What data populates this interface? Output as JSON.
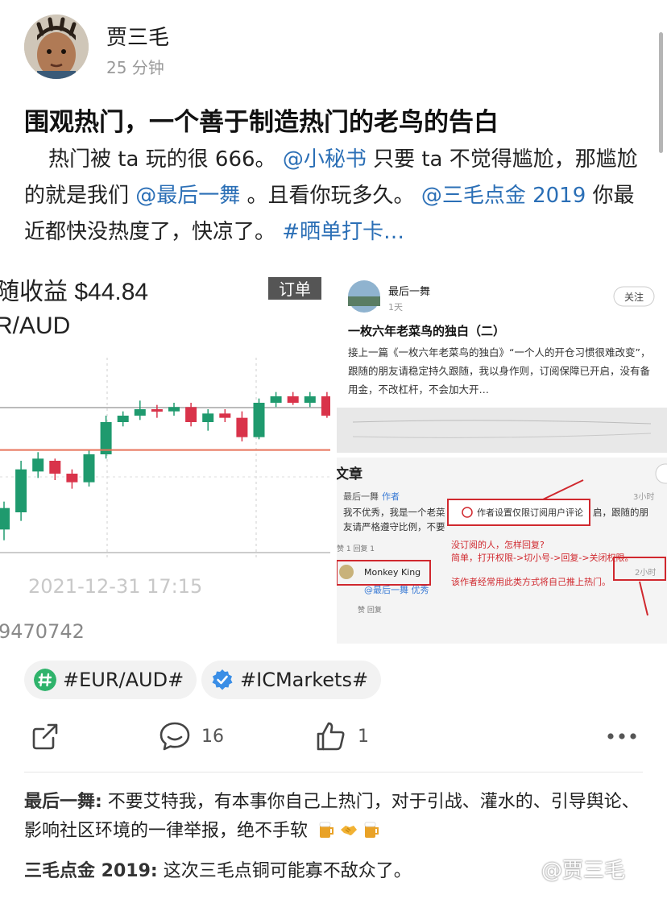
{
  "author": {
    "name": "贾三毛",
    "time": "25 分钟"
  },
  "post": {
    "title": "围观热门，一个善于制造热门的老鸟的告白",
    "segments": [
      {
        "text": "热门被 ta 玩的很 666。 ",
        "link": false
      },
      {
        "text": "@小秘书",
        "link": true
      },
      {
        "text": " 只要 ta 不觉得尴尬，那尴尬的就是我们 ",
        "link": false
      },
      {
        "text": "@最后一舞",
        "link": true
      },
      {
        "text": " 。且看你玩多久。 ",
        "link": false
      },
      {
        "text": "@三毛点金 2019",
        "link": true
      },
      {
        "text": " 你最近都快没热度了，快凉了。 ",
        "link": false
      },
      {
        "text": "#晒单打卡…",
        "link": true
      }
    ]
  },
  "images": {
    "chart_shot": {
      "headline": "随收益 $44.84",
      "pair": "R/AUD",
      "badge": "订单",
      "timestamp": "2021-12-31 17:15",
      "order_id": "9470742"
    },
    "article_shot": {
      "author": "最后一舞",
      "time": "1天",
      "follow": "关注",
      "title": "一枚六年老菜鸟的独白（二）",
      "excerpt": "接上一篇《一枚六年老菜鸟的独白》“一个人的开仓习惯很难改变”，跟随的朋友请稳定持久跟随，我以身作则，订阅保障已开启，没有备用金，不改杠杆，不会加大开…"
    },
    "comment_shot": {
      "tab": "文章",
      "c1_name": "最后一舞",
      "c1_tag": "作者",
      "c1_time": "3小时",
      "c1_text": "我不优秀，我是一个老菜",
      "c1_text_tail": "启，跟随的朋",
      "c1_line2": "友请严格遵守比例，不要",
      "popup": "作者设置仅限订阅用户评论",
      "c1_actions": "赞 1  回复 1",
      "note1": "没订阅的人，怎样回复?",
      "note2": "简单，打开权限->切小号->回复->关闭权限。",
      "note3": "该作者经常用此类方式将自己推上热门。",
      "c2_name": "Monkey King",
      "c2_time": "2小时",
      "c2_text": "@最后一舞 优秀",
      "c2_actions": "赞  回复"
    }
  },
  "topics": [
    {
      "label": "#EUR/AUD#",
      "icon": "hashtag-icon",
      "color": "#2fb36b"
    },
    {
      "label": "#ICMarkets#",
      "icon": "verified-icon",
      "color": "#3a8ee6"
    }
  ],
  "actions": {
    "comments": "16",
    "likes": "1"
  },
  "comments": [
    {
      "name": "最后一舞:",
      "text": " 不要艾特我，有本事你自己上热门，对于引战、灌水的、引导舆论、影响社区环境的一律举报，绝不手软",
      "emojis": [
        "beer-icon",
        "handshake-icon",
        "beer-icon"
      ]
    },
    {
      "name": "三毛点金 2019:",
      "text": " 这次三毛点铜可能寡不敌众了。",
      "emojis": []
    }
  ],
  "watermark": "@贾三毛",
  "chart_data": {
    "type": "candlestick",
    "title": "",
    "series": [
      {
        "name": "",
        "candles": [
          {
            "o": 1.552,
            "c": 1.553,
            "h": 1.5533,
            "l": 1.5515
          },
          {
            "o": 1.5528,
            "c": 1.5548,
            "h": 1.5552,
            "l": 1.5524
          },
          {
            "o": 1.5547,
            "c": 1.5553,
            "h": 1.5556,
            "l": 1.5544
          },
          {
            "o": 1.5552,
            "c": 1.5546,
            "h": 1.5553,
            "l": 1.5543
          },
          {
            "o": 1.5546,
            "c": 1.5542,
            "h": 1.5548,
            "l": 1.5539
          },
          {
            "o": 1.5542,
            "c": 1.5555,
            "h": 1.5557,
            "l": 1.554
          },
          {
            "o": 1.5555,
            "c": 1.557,
            "h": 1.5573,
            "l": 1.5553
          },
          {
            "o": 1.557,
            "c": 1.5573,
            "h": 1.5575,
            "l": 1.5568
          },
          {
            "o": 1.5573,
            "c": 1.5576,
            "h": 1.558,
            "l": 1.5571
          },
          {
            "o": 1.5576,
            "c": 1.5575,
            "h": 1.5578,
            "l": 1.5572
          },
          {
            "o": 1.5575,
            "c": 1.5577,
            "h": 1.5579,
            "l": 1.5573
          },
          {
            "o": 1.5577,
            "c": 1.557,
            "h": 1.5579,
            "l": 1.5568
          },
          {
            "o": 1.557,
            "c": 1.5574,
            "h": 1.5576,
            "l": 1.5566
          },
          {
            "o": 1.5574,
            "c": 1.5572,
            "h": 1.5576,
            "l": 1.557
          },
          {
            "o": 1.5572,
            "c": 1.5563,
            "h": 1.5575,
            "l": 1.5561
          },
          {
            "o": 1.5563,
            "c": 1.5579,
            "h": 1.5581,
            "l": 1.5562
          },
          {
            "o": 1.5579,
            "c": 1.5582,
            "h": 1.5584,
            "l": 1.5577
          },
          {
            "o": 1.5582,
            "c": 1.5579,
            "h": 1.5584,
            "l": 1.5578
          },
          {
            "o": 1.5579,
            "c": 1.5582,
            "h": 1.5584,
            "l": 1.5577
          },
          {
            "o": 1.5582,
            "c": 1.5573,
            "h": 1.5584,
            "l": 1.5572
          },
          {
            "o": 1.5573,
            "c": 1.5578,
            "h": 1.558,
            "l": 1.5571
          }
        ]
      }
    ],
    "reference_line": 1.5557,
    "ylim": [
      1.551,
      1.56
    ],
    "colors": {
      "up": "#1f9a6e",
      "down": "#d9334a",
      "reference": "#e8735a"
    },
    "grid": true
  }
}
